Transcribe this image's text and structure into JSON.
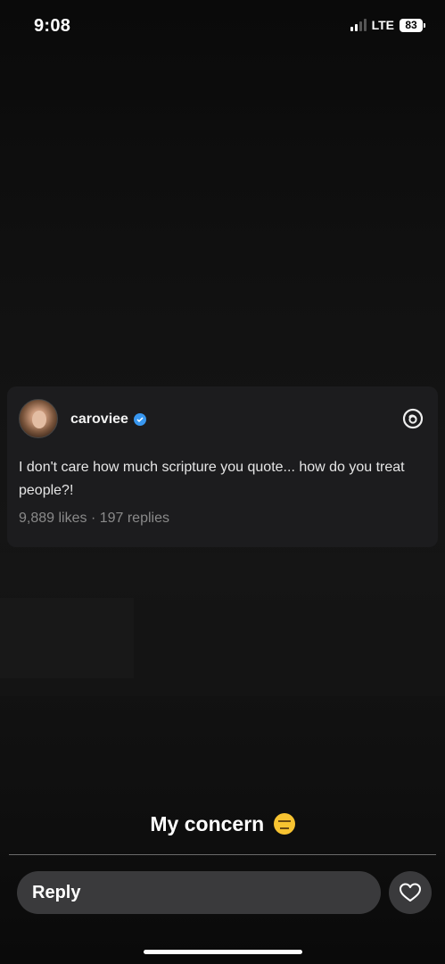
{
  "status_bar": {
    "time": "9:08",
    "network": "LTE",
    "battery": "83"
  },
  "thread_post": {
    "username": "caroviee",
    "verified": true,
    "text": "I don't care how much scripture you quote... how do you treat people?!",
    "stats": "9,889 likes · 197 replies",
    "app_icon": "threads-icon",
    "accent_color": "#3897f0"
  },
  "caption": {
    "text": "My concern",
    "emoji": "😑"
  },
  "reply_bar": {
    "placeholder": "Reply",
    "like_icon": "heart-icon"
  }
}
